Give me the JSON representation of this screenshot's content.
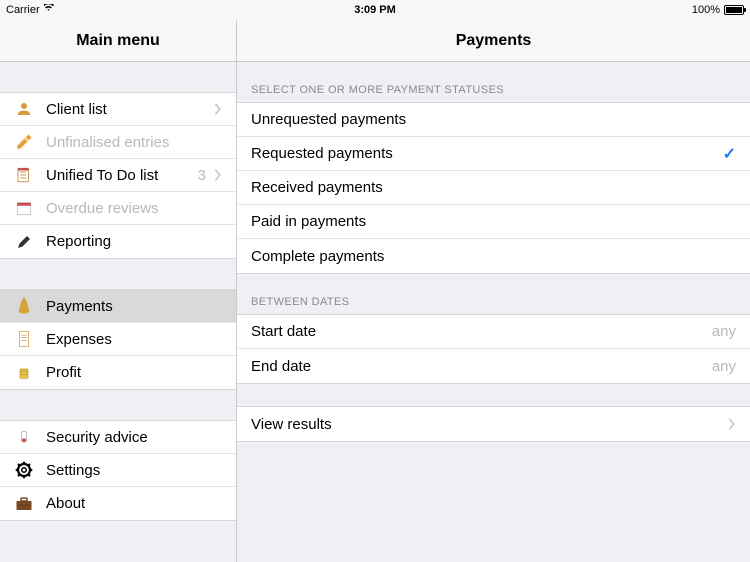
{
  "statusbar": {
    "carrier": "Carrier",
    "time": "3:09 PM",
    "battery_pct": "100%"
  },
  "titles": {
    "left": "Main menu",
    "right": "Payments"
  },
  "sidebar": {
    "group1": [
      {
        "label": "Client list",
        "disabled": false,
        "chevron": true,
        "badge": ""
      },
      {
        "label": "Unfinalised entries",
        "disabled": true,
        "chevron": false,
        "badge": ""
      },
      {
        "label": "Unified To Do list",
        "disabled": false,
        "chevron": true,
        "badge": "3"
      },
      {
        "label": "Overdue reviews",
        "disabled": true,
        "chevron": false,
        "badge": ""
      },
      {
        "label": "Reporting",
        "disabled": false,
        "chevron": false,
        "badge": ""
      }
    ],
    "group2": [
      {
        "label": "Payments",
        "selected": true
      },
      {
        "label": "Expenses",
        "selected": false
      },
      {
        "label": "Profit",
        "selected": false
      }
    ],
    "group3": [
      {
        "label": "Security advice"
      },
      {
        "label": "Settings"
      },
      {
        "label": "About"
      }
    ]
  },
  "statuses_header": "Select one or more payment statuses",
  "statuses": [
    {
      "label": "Unrequested payments",
      "checked": false
    },
    {
      "label": "Requested payments",
      "checked": true
    },
    {
      "label": "Received payments",
      "checked": false
    },
    {
      "label": "Paid in payments",
      "checked": false
    },
    {
      "label": "Complete payments",
      "checked": false
    }
  ],
  "dates_header": "Between dates",
  "dates": [
    {
      "label": "Start date",
      "value": "any"
    },
    {
      "label": "End date",
      "value": "any"
    }
  ],
  "view_results": "View results"
}
